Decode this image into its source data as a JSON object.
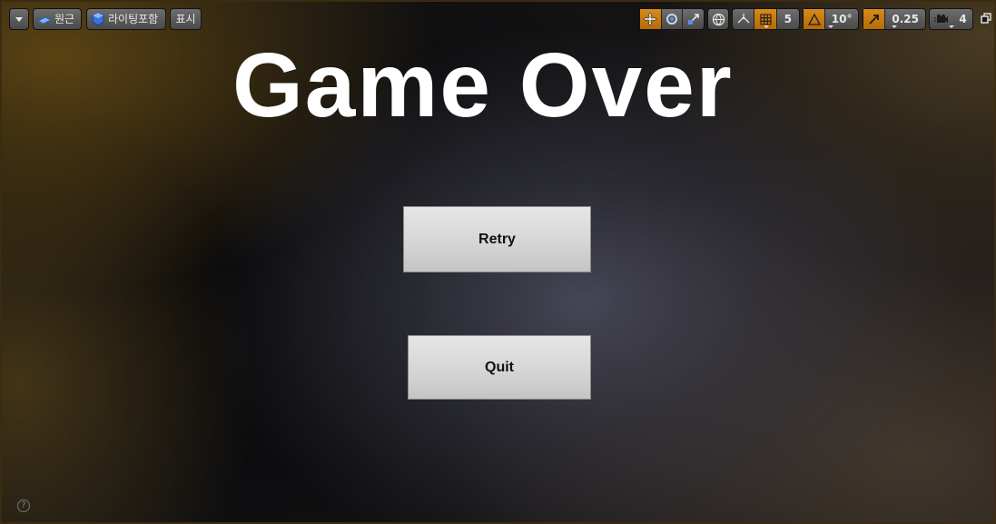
{
  "viewport_toolbar": {
    "options_menu_icon": "chevron-down-icon",
    "perspective_label": "원근",
    "lighting_label": "라이팅포함",
    "show_label": "표시",
    "grid_snap_value": "5",
    "rotation_snap_value": "10°",
    "scale_snap_value": "0.25",
    "camera_speed_value": "4",
    "accent_color": "#c97a10"
  },
  "game_ui": {
    "title": "Game Over",
    "retry_label": "Retry",
    "quit_label": "Quit"
  },
  "help_glyph": "?"
}
